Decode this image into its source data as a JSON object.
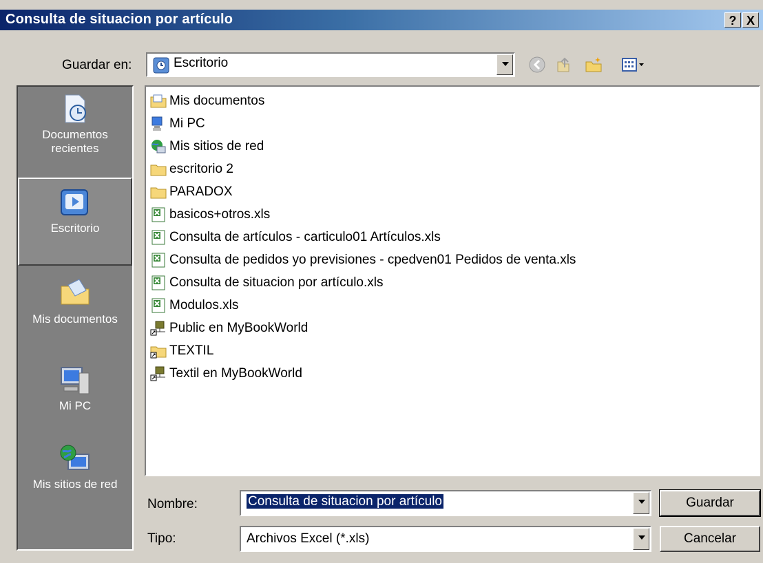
{
  "window": {
    "title": "Consulta de situacion por artículo",
    "help_label": "?",
    "close_label": "X"
  },
  "save_in": {
    "label": "Guardar en:",
    "value": "Escritorio"
  },
  "toolbar": {
    "icons": [
      "back-icon",
      "up-folder-icon",
      "new-folder-icon",
      "view-menu-icon"
    ]
  },
  "places": [
    {
      "label": "Documentos recientes",
      "icon": "recent-documents-icon"
    },
    {
      "label": "Escritorio",
      "icon": "desktop-icon",
      "selected": true
    },
    {
      "label": "Mis documentos",
      "icon": "my-documents-icon"
    },
    {
      "label": "Mi PC",
      "icon": "my-computer-icon"
    },
    {
      "label": "Mis sitios de red",
      "icon": "network-places-icon"
    }
  ],
  "files": [
    {
      "name": "Mis documentos",
      "icon": "my-documents-folder-icon"
    },
    {
      "name": "Mi PC",
      "icon": "my-computer-icon"
    },
    {
      "name": "Mis sitios de red",
      "icon": "network-places-icon"
    },
    {
      "name": "escritorio 2",
      "icon": "folder-icon"
    },
    {
      "name": "PARADOX",
      "icon": "folder-icon"
    },
    {
      "name": "basicos+otros.xls",
      "icon": "excel-file-icon"
    },
    {
      "name": "Consulta de artículos - carticulo01 Artículos.xls",
      "icon": "excel-file-icon"
    },
    {
      "name": "Consulta de pedidos yo previsiones - cpedven01 Pedidos de venta.xls",
      "icon": "excel-file-icon"
    },
    {
      "name": "Consulta de situacion por artículo.xls",
      "icon": "excel-file-icon"
    },
    {
      "name": "Modulos.xls",
      "icon": "excel-file-icon"
    },
    {
      "name": "Public en MyBookWorld",
      "icon": "network-shortcut-icon"
    },
    {
      "name": "TEXTIL",
      "icon": "folder-shortcut-icon"
    },
    {
      "name": "Textil en MyBookWorld",
      "icon": "network-shortcut-icon"
    }
  ],
  "filename": {
    "label": "Nombre:",
    "value": "Consulta de situacion por artículo"
  },
  "filetype": {
    "label": "Tipo:",
    "value": "Archivos Excel (*.xls)"
  },
  "buttons": {
    "save": "Guardar",
    "cancel": "Cancelar"
  },
  "colors": {
    "title_bar": "#0a246a",
    "selection": "#0a246a",
    "dialog_bg": "#d4d0c8",
    "places_bg": "#808080"
  }
}
